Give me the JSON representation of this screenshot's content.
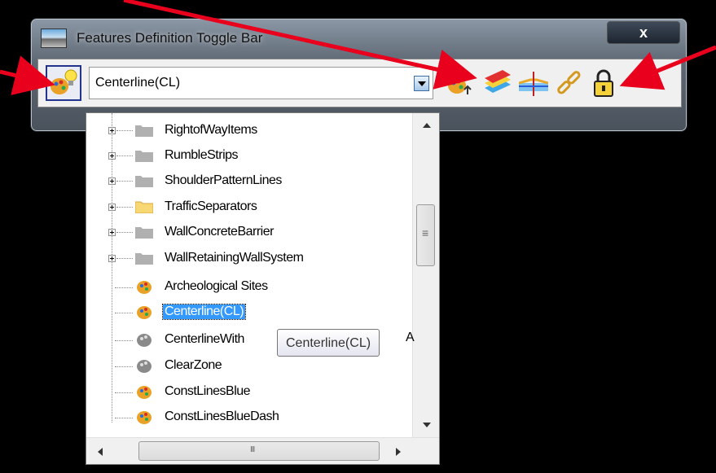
{
  "window": {
    "title": "Features Definition Toggle Bar",
    "close_label": "x"
  },
  "toolbar": {
    "selected_feature": "Centerline(CL)",
    "icons": [
      "feature-definition-toggle-icon",
      "palette-icon",
      "layers-icon",
      "cross-section-icon",
      "chain-link-icon",
      "padlock-icon"
    ]
  },
  "list": {
    "items": [
      {
        "label": "RightofWayItems",
        "type": "folder"
      },
      {
        "label": "RumbleStrips",
        "type": "folder"
      },
      {
        "label": "ShoulderPatternLines",
        "type": "folder"
      },
      {
        "label": "TrafficSeparators",
        "type": "folder-open"
      },
      {
        "label": "WallConcreteBarrier",
        "type": "folder"
      },
      {
        "label": "WallRetainingWallSystem",
        "type": "folder"
      },
      {
        "label": "Archeological Sites",
        "type": "feature"
      },
      {
        "label": "Centerline(CL)",
        "type": "feature",
        "selected": true
      },
      {
        "label": "CenterlineWith",
        "type": "feature-gray"
      },
      {
        "label": "ClearZone",
        "type": "feature-gray"
      },
      {
        "label": "ConstLinesBlue",
        "type": "feature"
      },
      {
        "label": "ConstLinesBlueDash",
        "type": "feature"
      }
    ],
    "clipped_text": "A"
  },
  "tooltip": {
    "text": "Centerline(CL)"
  },
  "colors": {
    "arrow": "#e8001c",
    "selection": "#3399ff"
  }
}
